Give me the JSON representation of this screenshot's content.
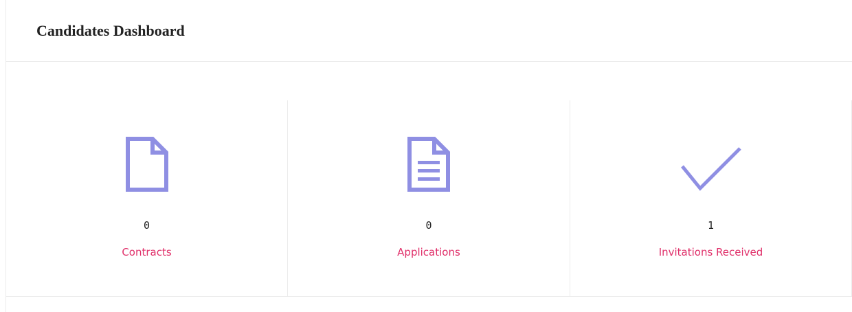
{
  "dashboard": {
    "title": "Candidates Dashboard"
  },
  "stats": [
    {
      "icon": "document-icon",
      "count": "0",
      "label": "Contracts"
    },
    {
      "icon": "text-document-icon",
      "count": "0",
      "label": "Applications"
    },
    {
      "icon": "checkmark-icon",
      "count": "1",
      "label": "Invitations Received"
    }
  ],
  "colors": {
    "icon": "#8f8fe3",
    "label": "#e0306a",
    "text": "#222222",
    "border": "#ececec"
  }
}
